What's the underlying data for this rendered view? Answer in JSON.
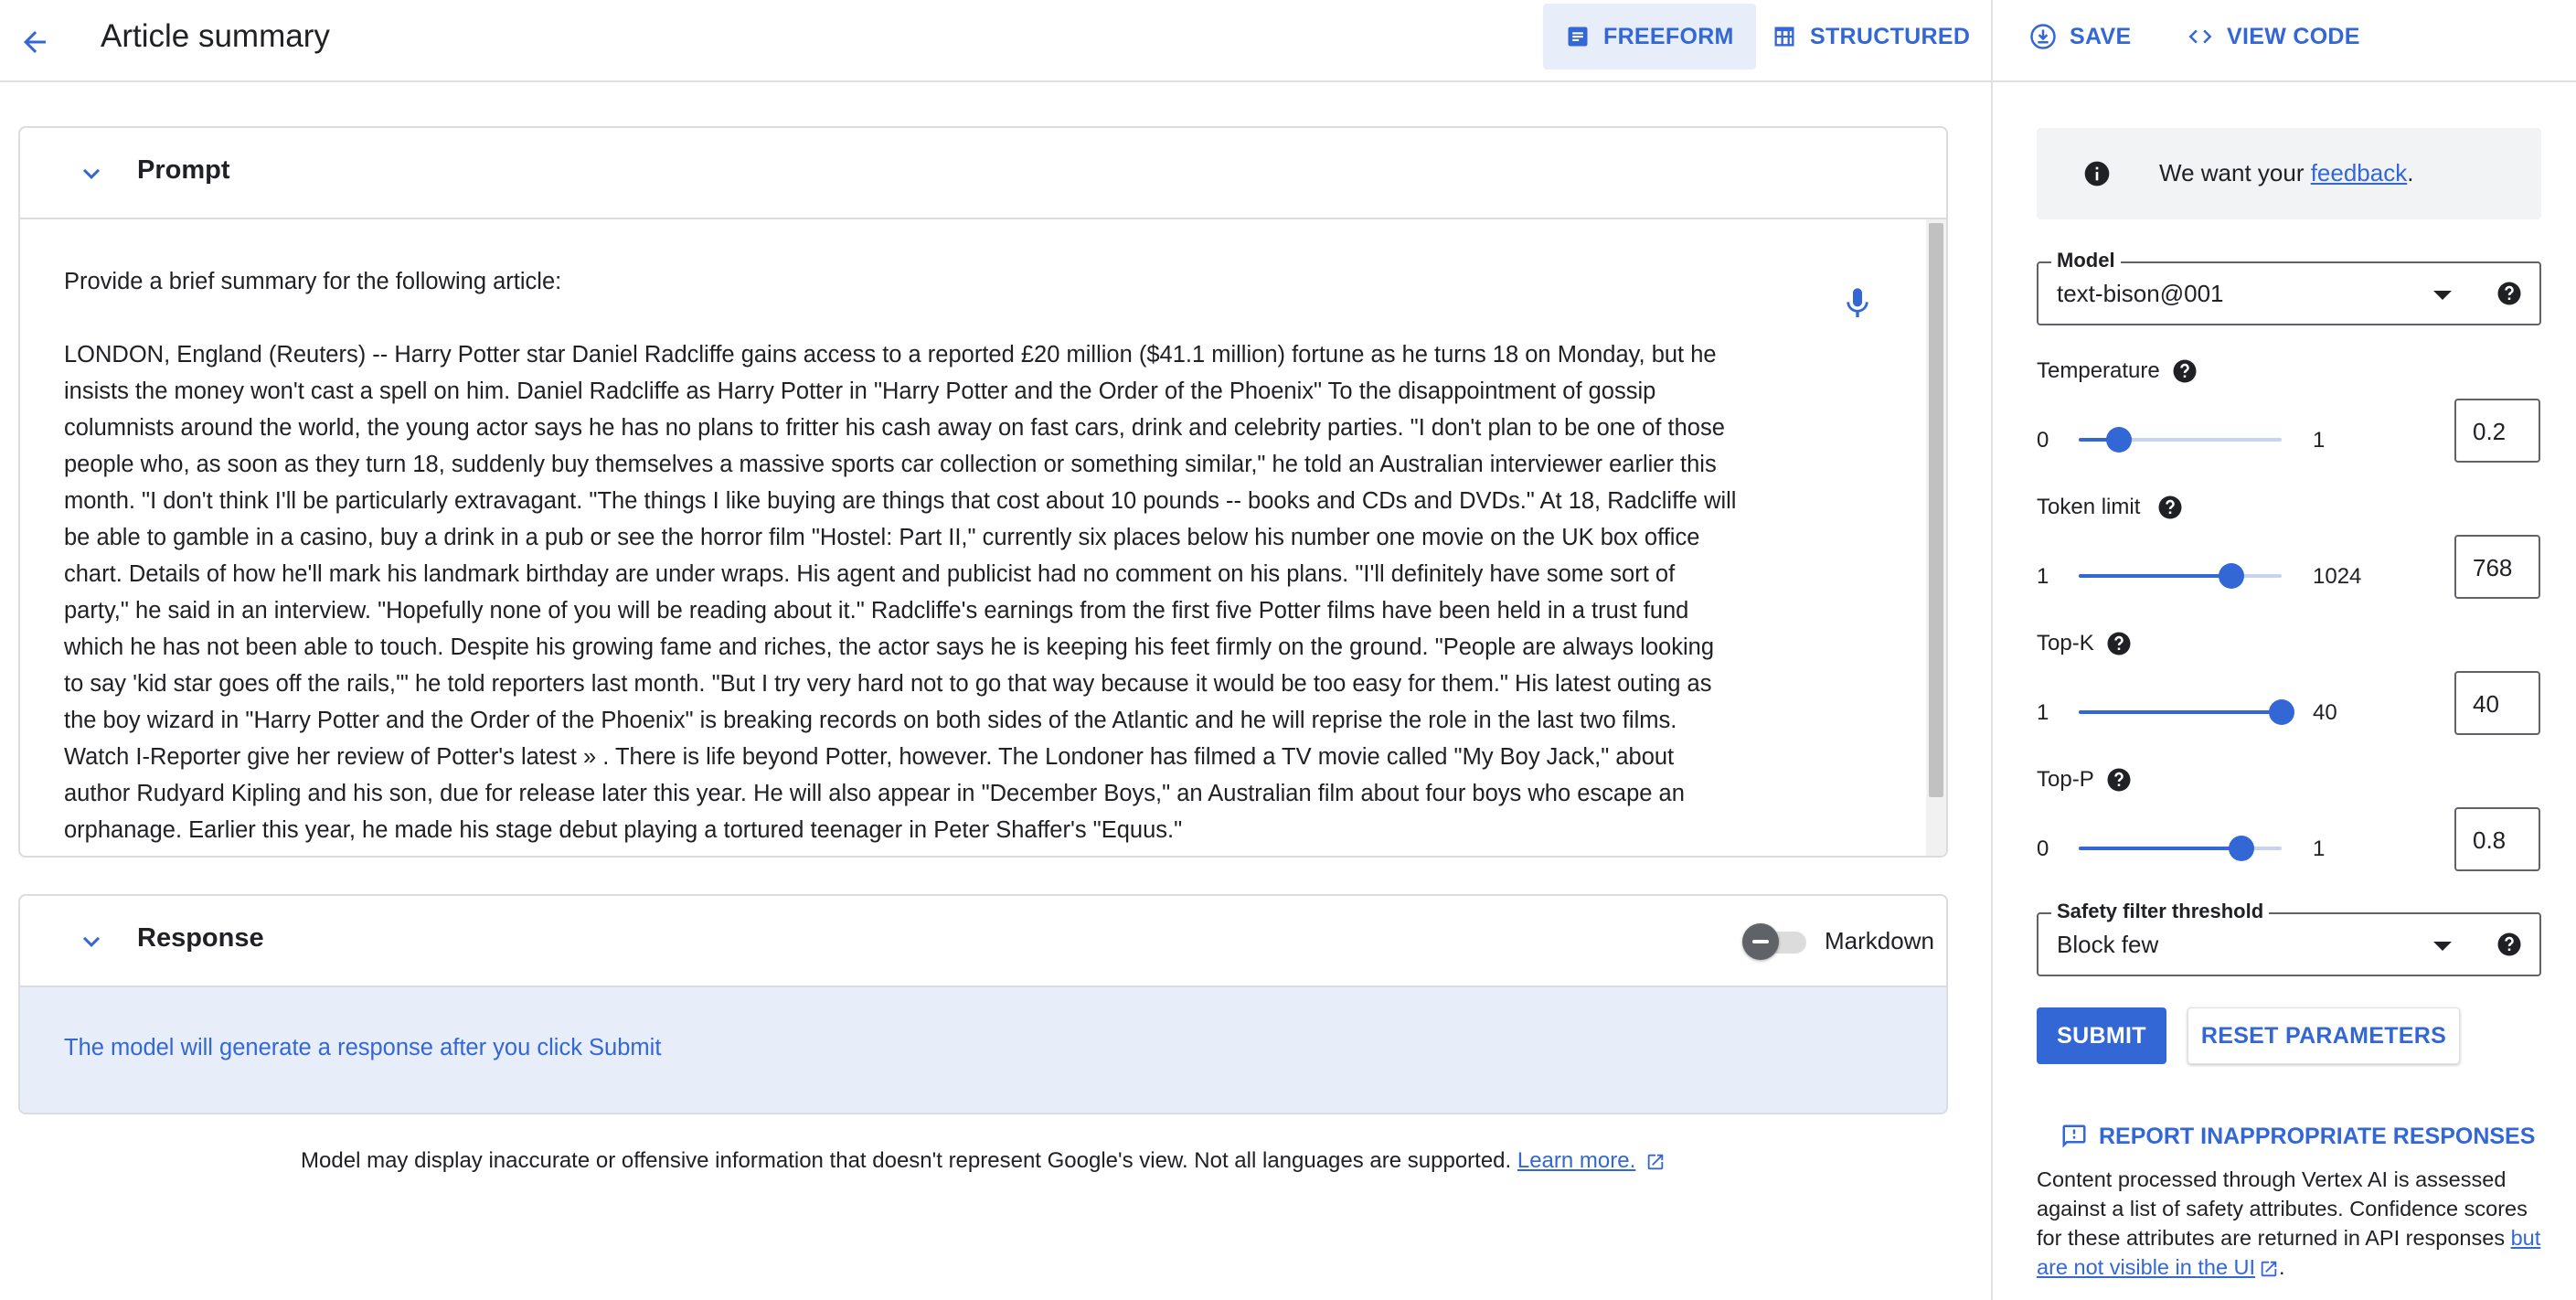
{
  "header": {
    "title": "Article summary",
    "modes": [
      {
        "label": "FREEFORM",
        "icon": "freeform-icon",
        "active": true
      },
      {
        "label": "STRUCTURED",
        "icon": "table-icon",
        "active": false
      }
    ],
    "actions": [
      {
        "label": "SAVE",
        "icon": "save-icon"
      },
      {
        "label": "VIEW CODE",
        "icon": "code-icon"
      }
    ]
  },
  "prompt": {
    "title": "Prompt",
    "paragraphs": [
      "Provide a brief summary for the following article:",
      "LONDON, England (Reuters) -- Harry Potter star Daniel Radcliffe gains access to a reported £20 million ($41.1 million) fortune as he turns 18 on Monday, but he insists the money won't cast a spell on him. Daniel Radcliffe as Harry Potter in \"Harry Potter and the Order of the Phoenix\" To the disappointment of gossip columnists around the world, the young actor says he has no plans to fritter his cash away on fast cars, drink and celebrity parties. \"I don't plan to be one of those people who, as soon as they turn 18, suddenly buy themselves a massive sports car collection or something similar,\" he told an Australian interviewer earlier this month. \"I don't think I'll be particularly extravagant. \"The things I like buying are things that cost about 10 pounds -- books and CDs and DVDs.\" At 18, Radcliffe will be able to gamble in a casino, buy a drink in a pub or see the horror film \"Hostel: Part II,\" currently six places below his number one movie on the UK box office chart. Details of how he'll mark his landmark birthday are under wraps. His agent and publicist had no comment on his plans. \"I'll definitely have some sort of party,\" he said in an interview. \"Hopefully none of you will be reading about it.\" Radcliffe's earnings from the first five Potter films have been held in a trust fund which he has not been able to touch. Despite his growing fame and riches, the actor says he is keeping his feet firmly on the ground. \"People are always looking to say 'kid star goes off the rails,'\" he told reporters last month. \"But I try very hard not to go that way because it would be too easy for them.\" His latest outing as the boy wizard in \"Harry Potter and the Order of the Phoenix\" is breaking records on both sides of the Atlantic and he will reprise the role in the last two films. Watch I-Reporter give her review of Potter's latest » . There is life beyond Potter, however. The Londoner has filmed a TV movie called \"My Boy Jack,\" about author Rudyard Kipling and his son, due for release later this year. He will also appear in \"December Boys,\" an Australian film about four boys who escape an orphanage. Earlier this year, he made his stage debut playing a tortured teenager in Peter Shaffer's \"Equus.\""
    ]
  },
  "response": {
    "title": "Response",
    "hint": "The model will generate a response after you click Submit",
    "markdown_label": "Markdown",
    "markdown_on": false
  },
  "disclaimer": {
    "text": "Model may display inaccurate or offensive information that doesn't represent Google's view. Not all languages are supported.",
    "link": "Learn more."
  },
  "sidebar": {
    "feedback": {
      "prefix": "We want your ",
      "link": "feedback",
      "suffix": "."
    },
    "model": {
      "label": "Model",
      "value": "text-bison@001"
    },
    "params": {
      "temperature": {
        "label": "Temperature",
        "min": "0",
        "max": "1",
        "value": "0.2",
        "fraction": 0.2
      },
      "token_limit": {
        "label": "Token limit",
        "min": "1",
        "max": "1024",
        "value": "768",
        "fraction": 0.75
      },
      "top_k": {
        "label": "Top-K",
        "min": "1",
        "max": "40",
        "value": "40",
        "fraction": 1.0
      },
      "top_p": {
        "label": "Top-P",
        "min": "0",
        "max": "1",
        "value": "0.8",
        "fraction": 0.8
      }
    },
    "safety": {
      "label": "Safety filter threshold",
      "value": "Block few"
    },
    "submit_label": "SUBMIT",
    "reset_label": "RESET PARAMETERS",
    "report_label": "REPORT INAPPROPRIATE RESPONSES",
    "safety_note": "Content processed through Vertex AI is assessed against a list of safety attributes. Confidence scores for these attributes are returned in API responses ",
    "safety_note_link": "but are not visible in the UI",
    "safety_note_end": "."
  },
  "colors": {
    "accent": "#3367d6",
    "accent_light": "#e8eef9",
    "border": "#dadce0"
  }
}
